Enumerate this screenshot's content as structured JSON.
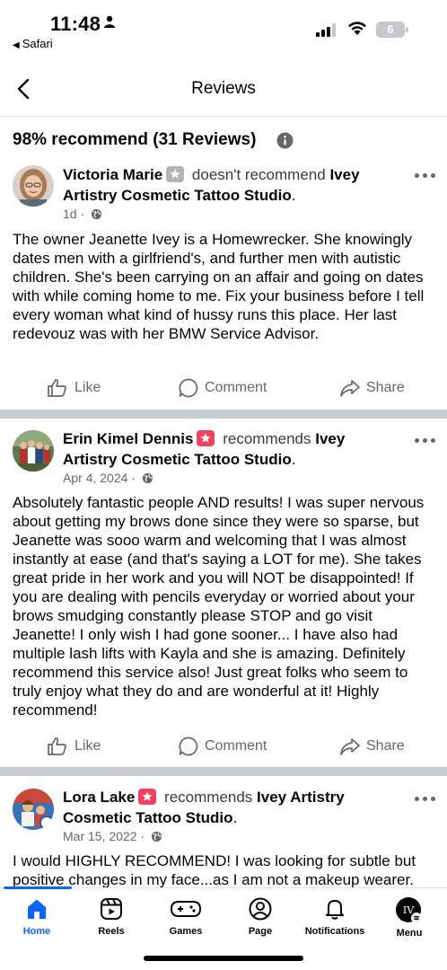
{
  "status_bar": {
    "time": "11:48",
    "back_app": "Safari",
    "battery": "6"
  },
  "header": {
    "title": "Reviews"
  },
  "summary": {
    "text": "98% recommend (31 Reviews)"
  },
  "reviews": [
    {
      "name": "Victoria Marie",
      "verb": "doesn't recommend",
      "page": "Ivey Artistry Cosmetic Tattoo Studio",
      "date": "1d",
      "body": "The owner Jeanette Ivey is a Homewrecker. She knowingly dates men with a girlfriend's, and further men with autistic children. She's been carrying on an affair and going on dates with while coming home to me. Fix your business before I tell every woman what kind of hussy runs this place. Her last redevouz was with her BMW Service Advisor.",
      "badge_color": "#b0b3b8"
    },
    {
      "name": "Erin Kimel Dennis",
      "verb": "recommends",
      "page": "Ivey Artistry Cosmetic Tattoo Studio",
      "date": "Apr 4, 2024",
      "body": "Absolutely fantastic people AND results! I was super nervous about getting my brows done since they were so sparse, but Jeanette was sooo warm and welcoming that I was almost instantly at ease (and that's saying a LOT for me). She takes great pride in her work and you will NOT be disappointed! If you are dealing with pencils everyday or worried about your brows smudging constantly please STOP and go visit Jeanette! I only wish I had gone sooner... I have also had multiple lash lifts with Kayla and she is amazing. Definitely recommend this service also! Just great folks who seem to truly enjoy what they do and are wonderful at it! Highly recommend!",
      "badge_color": "#f3425f"
    },
    {
      "name": "Lora Lake",
      "verb": "recommends",
      "page": "Ivey Artistry Cosmetic Tattoo Studio",
      "date": "Mar 15, 2022",
      "body": "I would HIGHLY RECOMMEND! I was looking for subtle but positive changes in my face...as I am not a makeup wearer.",
      "badge_color": "#f3425f"
    }
  ],
  "actions": {
    "like": "Like",
    "comment": "Comment",
    "share": "Share"
  },
  "nav": {
    "home": "Home",
    "reels": "Reels",
    "games": "Games",
    "page": "Page",
    "notifications": "Notifications",
    "menu": "Menu"
  },
  "colors": {
    "accent": "#0866ff",
    "recommend_badge": "#f3425f",
    "separator": "#c9ccd1"
  }
}
